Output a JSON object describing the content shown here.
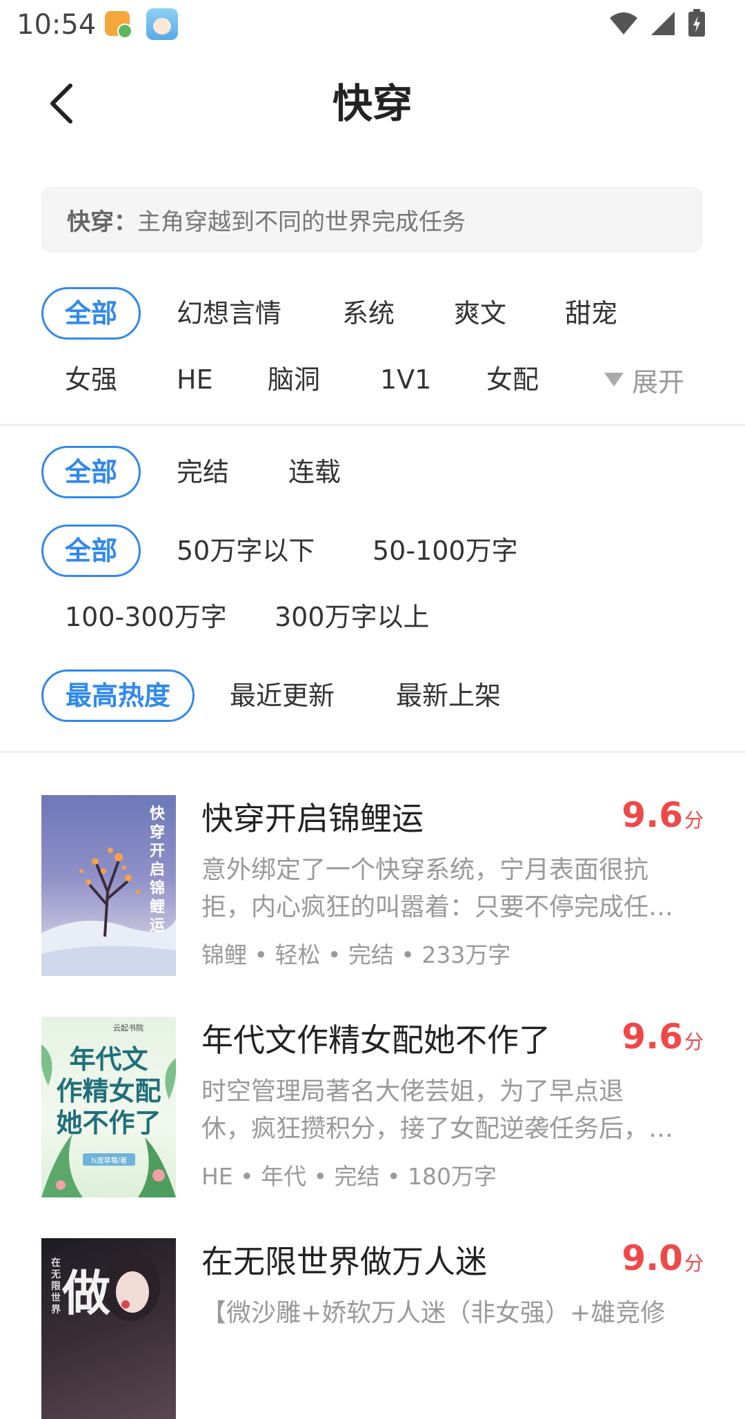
{
  "status_bar": {
    "time": "10:54"
  },
  "header": {
    "title": "快穿"
  },
  "description": {
    "label": "快穿：",
    "text": "主角穿越到不同的世界完成任务"
  },
  "tag_filters": {
    "all": "全部",
    "row1": [
      "幻想言情",
      "系统",
      "爽文",
      "甜宠"
    ],
    "row2": [
      "女强",
      "HE",
      "脑洞",
      "1V1",
      "女配"
    ],
    "expand_label": "展开"
  },
  "status_filters": {
    "all": "全部",
    "options": [
      "完结",
      "连载"
    ]
  },
  "word_filters": {
    "all": "全部",
    "row1": [
      "50万字以下",
      "50-100万字"
    ],
    "row2": [
      "100-300万字",
      "300万字以上"
    ]
  },
  "sort_filters": {
    "active": "最高热度",
    "options": [
      "最近更新",
      "最新上架"
    ]
  },
  "books": [
    {
      "title": "快穿开启锦鲤运",
      "score": "9.6",
      "score_unit": "分",
      "synopsis_line1": "意外绑定了一个快穿系统，宁月表面很抗",
      "synopsis_line2": "拒，内心疯狂的叫嚣着：只要不停完成任…",
      "meta": "锦鲤 • 轻松 • 完结 • 233万字",
      "cover_text": "快穿开启锦鲤运"
    },
    {
      "title": "年代文作精女配她不作了",
      "score": "9.6",
      "score_unit": "分",
      "synopsis_line1": "时空管理局著名大佬芸姐，为了早点退",
      "synopsis_line2": "休，疯狂攒积分，接了女配逆袭任务后，…",
      "meta": "HE • 年代 • 完结 • 180万字",
      "cover_publisher": "云起书院",
      "cover_line1": "年代文",
      "cover_line2": "作精女配",
      "cover_line3": "她不作了",
      "cover_author": "N度草莓/著"
    },
    {
      "title": "在无限世界做万人迷",
      "score": "9.0",
      "score_unit": "分",
      "synopsis_line1": "【微沙雕+娇软万人迷（非女强）+雄竞修",
      "cover_small": "在无限世界",
      "cover_big": "做"
    }
  ],
  "colors": {
    "accent": "#2f88ef",
    "score": "#f04848"
  }
}
